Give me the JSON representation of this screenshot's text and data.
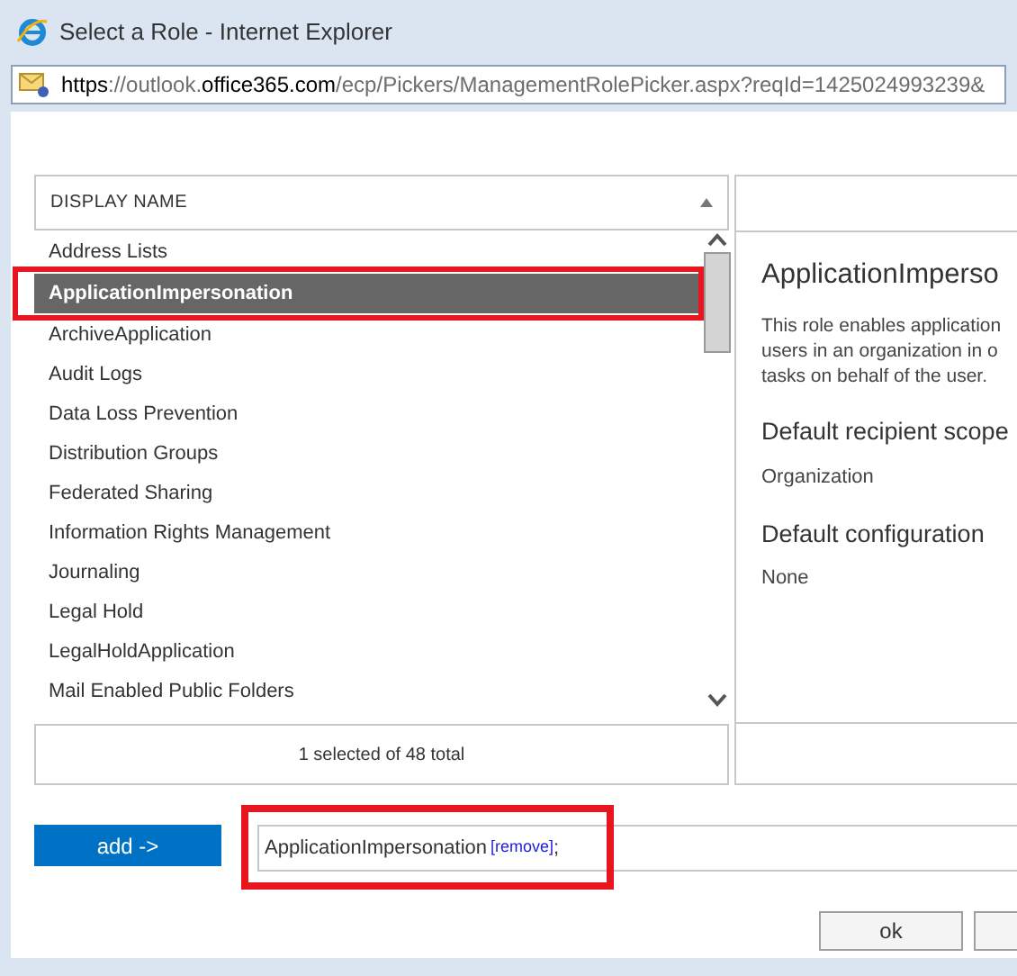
{
  "window": {
    "title": "Select a Role - Internet Explorer"
  },
  "address_bar": {
    "parts": [
      {
        "text": "https",
        "kind": "strong"
      },
      {
        "text": "://outlook.",
        "kind": "dim"
      },
      {
        "text": "office365.com",
        "kind": "strong"
      },
      {
        "text": "/ecp/Pickers/ManagementRolePicker.aspx?reqId=1425024993239&",
        "kind": "dim"
      }
    ]
  },
  "list": {
    "column": "DISPLAY NAME",
    "items": [
      {
        "label": "Address Lists",
        "selected": false
      },
      {
        "label": "ApplicationImpersonation",
        "selected": true
      },
      {
        "label": "ArchiveApplication",
        "selected": false
      },
      {
        "label": "Audit Logs",
        "selected": false
      },
      {
        "label": "Data Loss Prevention",
        "selected": false
      },
      {
        "label": "Distribution Groups",
        "selected": false
      },
      {
        "label": "Federated Sharing",
        "selected": false
      },
      {
        "label": "Information Rights Management",
        "selected": false
      },
      {
        "label": "Journaling",
        "selected": false
      },
      {
        "label": "Legal Hold",
        "selected": false
      },
      {
        "label": "LegalHoldApplication",
        "selected": false
      },
      {
        "label": "Mail Enabled Public Folders",
        "selected": false
      }
    ],
    "status": "1 selected of 48 total"
  },
  "details": {
    "title": "ApplicationImperso",
    "description": [
      "This role enables application",
      "users in an organization in o",
      "tasks on behalf of the user."
    ],
    "sections": [
      {
        "heading": "Default recipient scope",
        "value": "Organization"
      },
      {
        "heading": "Default configuration",
        "value": "None"
      }
    ]
  },
  "add_button": "add ->",
  "selection": {
    "value": "ApplicationImpersonation",
    "link": "[remove]",
    "separator": ";"
  },
  "buttons": [
    "ok"
  ]
}
